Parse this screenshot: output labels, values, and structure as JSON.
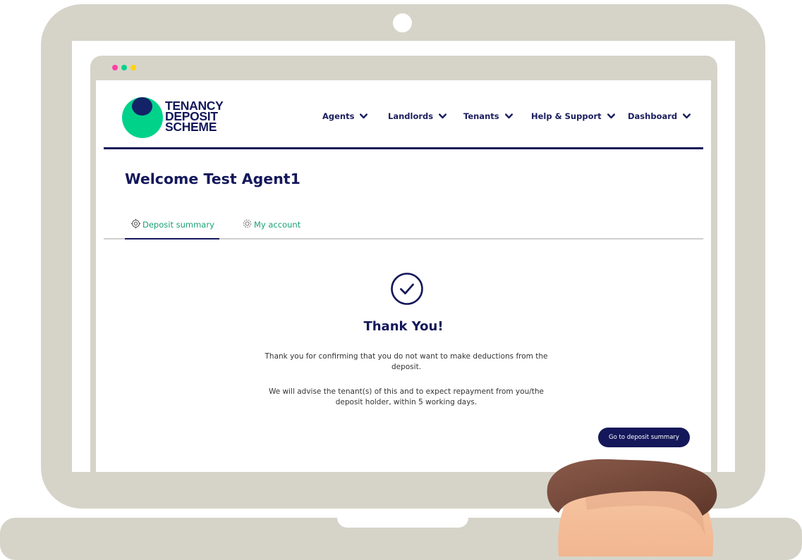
{
  "browser": {
    "dot_colors": [
      "#ff3fa4",
      "#00d28a",
      "#ffd400"
    ]
  },
  "brand": {
    "name_lines": [
      "TENANCY",
      "DEPOSIT",
      "SCHEME"
    ],
    "colors": {
      "navy": "#14185a",
      "green": "#00d28a",
      "tab_green": "#19a272"
    }
  },
  "nav": {
    "items": [
      {
        "label": "Agents",
        "icon": "chevron-down-icon"
      },
      {
        "label": "Landlords",
        "icon": "chevron-down-icon"
      },
      {
        "label": "Tenants",
        "icon": "chevron-down-icon"
      },
      {
        "label": "Help & Support",
        "icon": "chevron-down-icon"
      },
      {
        "label": "Dashboard",
        "icon": "chevron-down-icon"
      }
    ]
  },
  "page": {
    "welcome": "Welcome Test Agent1"
  },
  "tabs": [
    {
      "label": "Deposit summary",
      "icon": "deposit-icon",
      "active": true
    },
    {
      "label": "My account",
      "icon": "account-gear-icon",
      "active": false
    }
  ],
  "confirmation": {
    "icon": "check-circle-icon",
    "title": "Thank You!",
    "message_1": "Thank you for confirming that you do not want to make deductions from the deposit.",
    "message_2": "We will advise the tenant(s) of this and to expect repayment from you/the deposit holder, within 5 working days.",
    "button_label": "Go to deposit summary"
  }
}
